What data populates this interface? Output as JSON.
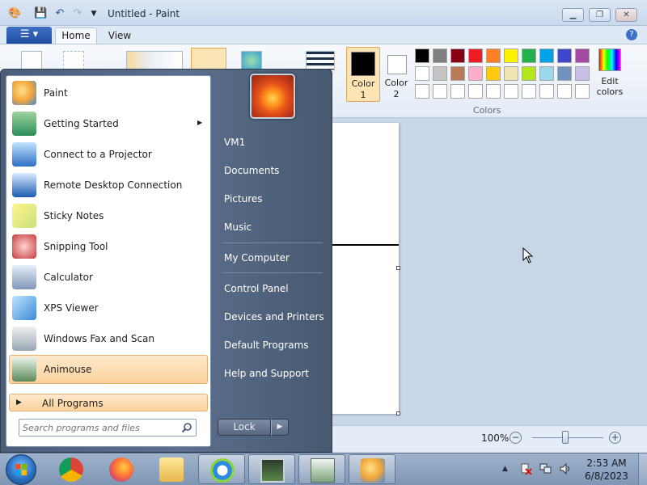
{
  "window": {
    "title": "Untitled - Paint",
    "minimize_icon": "minimize-icon",
    "maximize_icon": "maximize-icon",
    "close_icon": "close-icon"
  },
  "quick_access": [
    "paint-app-icon",
    "save-icon",
    "undo-icon",
    "redo-icon",
    "customize-dropdown-icon"
  ],
  "tabs": [
    {
      "label": "Home",
      "selected": true
    },
    {
      "label": "View",
      "selected": false
    }
  ],
  "ribbon": {
    "color1_label": "Color\n1",
    "color2_label": "Color\n2",
    "colors_group_label": "Colors",
    "edit_colors_label": "Edit\ncolors",
    "color1_value": "#000000",
    "color2_value": "#ffffff",
    "palette": [
      "#000000",
      "#7f7f7f",
      "#880015",
      "#ed1c24",
      "#ff7f27",
      "#fff200",
      "#22b14c",
      "#00a2e8",
      "#3f48cc",
      "#a349a4",
      "#ffffff",
      "#c3c3c3",
      "#b97a57",
      "#ffaec9",
      "#ffc90e",
      "#efe4b0",
      "#b5e61d",
      "#99d9ea",
      "#7092be",
      "#c8bfe7",
      "#ffffff",
      "#ffffff",
      "#ffffff",
      "#ffffff",
      "#ffffff",
      "#ffffff",
      "#ffffff",
      "#ffffff",
      "#ffffff",
      "#ffffff"
    ]
  },
  "status": {
    "zoom": "100%",
    "zoom_level": 1.0
  },
  "start_menu": {
    "programs": [
      {
        "label": "Paint",
        "icon": "paint-icon",
        "has_submenu": false,
        "selected": false
      },
      {
        "label": "Getting Started",
        "icon": "getting-started-icon",
        "has_submenu": true,
        "selected": false
      },
      {
        "label": "Connect to a Projector",
        "icon": "projector-icon",
        "has_submenu": false,
        "selected": false
      },
      {
        "label": "Remote Desktop Connection",
        "icon": "remote-desktop-icon",
        "has_submenu": false,
        "selected": false
      },
      {
        "label": "Sticky Notes",
        "icon": "sticky-notes-icon",
        "has_submenu": false,
        "selected": false
      },
      {
        "label": "Snipping Tool",
        "icon": "snipping-tool-icon",
        "has_submenu": false,
        "selected": false
      },
      {
        "label": "Calculator",
        "icon": "calculator-icon",
        "has_submenu": false,
        "selected": false
      },
      {
        "label": "XPS Viewer",
        "icon": "xps-viewer-icon",
        "has_submenu": false,
        "selected": false
      },
      {
        "label": "Windows Fax and Scan",
        "icon": "fax-scan-icon",
        "has_submenu": false,
        "selected": false
      },
      {
        "label": "Animouse",
        "icon": "animouse-icon",
        "has_submenu": false,
        "selected": true
      }
    ],
    "all_programs": "All Programs",
    "search_placeholder": "Search programs and files",
    "places": [
      {
        "label": "VM1"
      },
      {
        "label": "Documents"
      },
      {
        "label": "Pictures"
      },
      {
        "label": "Music"
      },
      {
        "label": "My Computer"
      },
      {
        "label": "Control Panel"
      },
      {
        "label": "Devices and Printers"
      },
      {
        "label": "Default Programs"
      },
      {
        "label": "Help and Support"
      }
    ],
    "lock_label": "Lock"
  },
  "taskbar": {
    "pinned": [
      {
        "name": "chrome-icon",
        "open": false
      },
      {
        "name": "firefox-icon",
        "open": false
      },
      {
        "name": "file-explorer-icon",
        "open": false
      },
      {
        "name": "browser-icon",
        "open": true
      },
      {
        "name": "monitor-app-icon",
        "open": true
      },
      {
        "name": "animouse-app-icon",
        "open": true
      },
      {
        "name": "paint-app-icon",
        "open": true
      }
    ],
    "time": "2:53 AM",
    "date": "6/8/2023"
  }
}
